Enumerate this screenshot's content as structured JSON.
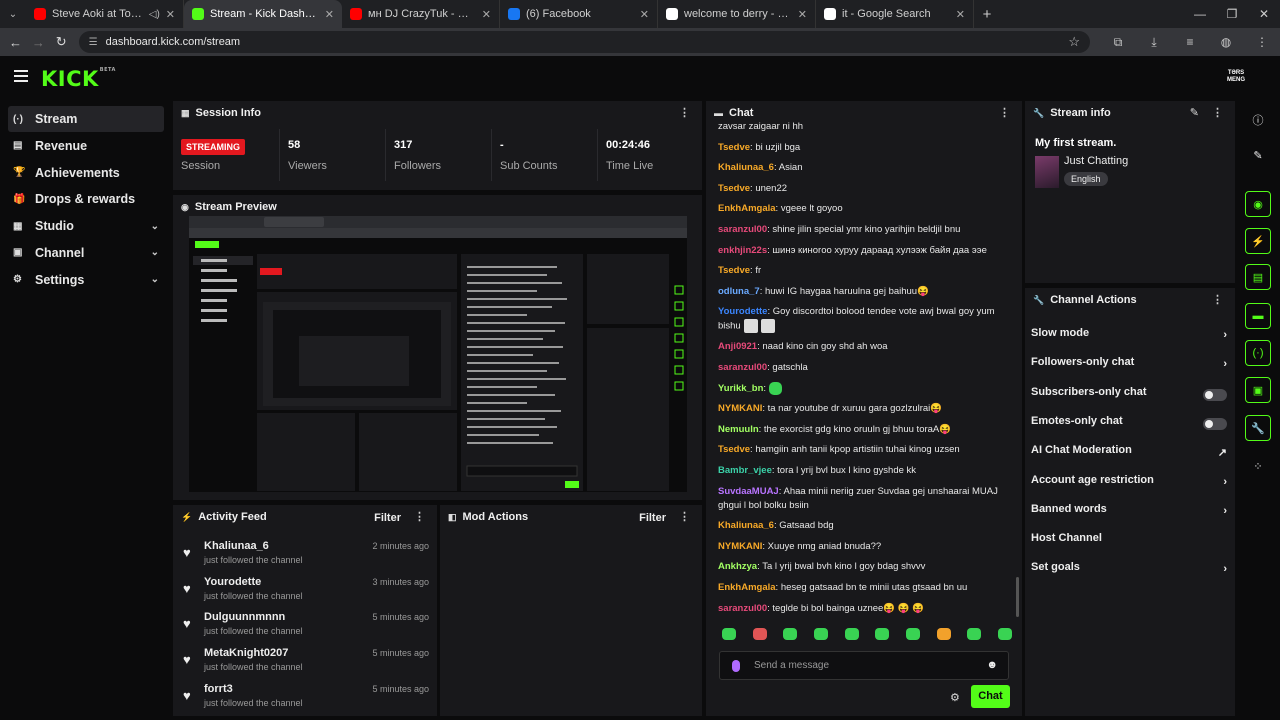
{
  "browser": {
    "tabs": [
      {
        "title": "Steve Aoki at Tomorrowland",
        "color": "#ff0000"
      },
      {
        "title": "Stream - Kick Dashboard",
        "color": "#53fc18"
      },
      {
        "title": "мн DJ CrazyTuk - Mixset (LIVE)",
        "color": "#ff0000"
      },
      {
        "title": "(6) Facebook",
        "color": "#1877f2"
      },
      {
        "title": "welcome to derry - Google Sea",
        "color": "#ffffff"
      },
      {
        "title": "it - Google Search",
        "color": "#ffffff"
      }
    ],
    "url": "dashboard.kick.com/stream"
  },
  "brand": {
    "logo": "KICK",
    "beta": "BETA",
    "accent": "#53fc18",
    "avatar_text": "TƏRS MENG"
  },
  "nav": [
    {
      "label": "Stream",
      "icon": "broadcast-icon",
      "glyph": "(·)",
      "active": true,
      "chevron": false
    },
    {
      "label": "Revenue",
      "icon": "revenue-icon",
      "glyph": "▤",
      "active": false,
      "chevron": false
    },
    {
      "label": "Achievements",
      "icon": "trophy-icon",
      "glyph": "🏆",
      "active": false,
      "chevron": false
    },
    {
      "label": "Drops & rewards",
      "icon": "gift-icon",
      "glyph": "🎁",
      "active": false,
      "chevron": false
    },
    {
      "label": "Studio",
      "icon": "studio-icon",
      "glyph": "▦",
      "active": false,
      "chevron": true
    },
    {
      "label": "Channel",
      "icon": "channel-icon",
      "glyph": "▣",
      "active": false,
      "chevron": true
    },
    {
      "label": "Settings",
      "icon": "gear-icon",
      "glyph": "⚙",
      "active": false,
      "chevron": true
    }
  ],
  "session": {
    "title": "Session Info",
    "status": "STREAMING",
    "stats": [
      {
        "value": "",
        "label": "Session"
      },
      {
        "value": "58",
        "label": "Viewers"
      },
      {
        "value": "317",
        "label": "Followers"
      },
      {
        "value": "-",
        "label": "Sub Counts"
      },
      {
        "value": "00:24:46",
        "label": "Time Live"
      }
    ]
  },
  "preview": {
    "title": "Stream Preview"
  },
  "activity": {
    "title": "Activity Feed",
    "filter": "Filter",
    "items": [
      {
        "name": "Khaliunaa_6",
        "sub": "just followed the channel",
        "time": "2 minutes ago"
      },
      {
        "name": "Yourodette",
        "sub": "just followed the channel",
        "time": "3 minutes ago"
      },
      {
        "name": "Dulguunnmnnn",
        "sub": "just followed the channel",
        "time": "5 minutes ago"
      },
      {
        "name": "MetaKnight0207",
        "sub": "just followed the channel",
        "time": "5 minutes ago"
      },
      {
        "name": "forrt3",
        "sub": "just followed the channel",
        "time": "5 minutes ago"
      }
    ]
  },
  "mod": {
    "title": "Mod Actions",
    "filter": "Filter"
  },
  "chat": {
    "title": "Chat",
    "messages": [
      {
        "user": "",
        "color": "#ffffff",
        "text": "zavsar zaigaar ni hh"
      },
      {
        "user": "Tsedve",
        "color": "#f7a928",
        "text": "bi uzjil bga"
      },
      {
        "user": "Khaliunaa_6",
        "color": "#f7a928",
        "text": "Asian"
      },
      {
        "user": "Tsedve",
        "color": "#f7a928",
        "text": "unen22"
      },
      {
        "user": "EnkhAmgala",
        "color": "#f7a928",
        "text": "vgeee lt goyoo"
      },
      {
        "user": "saranzul00",
        "color": "#e64a7a",
        "text": "shine jilin special ymr kino yarihjin beldjil bnu"
      },
      {
        "user": "enkhjin22s",
        "color": "#e64a7a",
        "text": "шинэ киноrоо хуруу дараад хулээж байя даа ээе"
      },
      {
        "user": "Tsedve",
        "color": "#f7a928",
        "text": "fr"
      },
      {
        "user": "odluna_7",
        "color": "#6aa9ff",
        "text": "huwi IG haygaa haruulna gej baihuu😝"
      },
      {
        "user": "Yourodette",
        "color": "#3b86ff",
        "text": "Goy discordtoi bolood tendee vote awj bwal goy yum bishu"
      },
      {
        "user": "Anji0921",
        "color": "#e64a7a",
        "text": "naad kino cin goy shd ah woa"
      },
      {
        "user": "saranzul00",
        "color": "#e64a7a",
        "text": "gatschla"
      },
      {
        "user": "Yurikk_bn",
        "color": "#a2ff63",
        "text": ""
      },
      {
        "user": "NYMKANI",
        "color": "#f7a928",
        "text": "ta nar youtube dr xuruu gara gozlzulrai😝"
      },
      {
        "user": "Nemuuln",
        "color": "#a2ff63",
        "text": "the exorcist gdg kino oruuln gj bhuu toraA😝"
      },
      {
        "user": "Tsedve",
        "color": "#f7a928",
        "text": "hamgiin anh tanii kpop artistiin tuhai kinog uzsen"
      },
      {
        "user": "Bambr_vjee",
        "color": "#3bd1a8",
        "text": "tora l yrij bvl bux l kino gyshde kk"
      },
      {
        "user": "SuvdaaMUAJ",
        "color": "#b874ff",
        "text": "Ahaa minii neriig zuer Suvdaa gej unshaarai MUAJ ghgui l bol bolku bsiin"
      },
      {
        "user": "Khaliunaa_6",
        "color": "#f7a928",
        "text": "Gatsaad bdg"
      },
      {
        "user": "NYMKANI",
        "color": "#f7a928",
        "text": "Xuuye nmg aniad bnuda??"
      },
      {
        "user": "Ankhzya",
        "color": "#a2ff63",
        "text": "Ta l yrij bwal bvh kino l goy bdag shvvv"
      },
      {
        "user": "EnkhAmgala",
        "color": "#f7a928",
        "text": "heseg gatsaad bn te minii utas gtsaad bn uu"
      },
      {
        "user": "saranzul00",
        "color": "#e64a7a",
        "text": "teglde bi bol bainga uznee😝 😝 😝"
      }
    ],
    "placeholder": "Send a message",
    "send_label": "Chat"
  },
  "stream_info": {
    "title": "Stream info",
    "stream_title": "My first stream.",
    "category": "Just Chatting",
    "language": "English"
  },
  "channel_actions": {
    "title": "Channel Actions",
    "items": [
      {
        "label": "Slow mode",
        "control": "chevron"
      },
      {
        "label": "Followers-only chat",
        "control": "chevron"
      },
      {
        "label": "Subscribers-only chat",
        "control": "toggle"
      },
      {
        "label": "Emotes-only chat",
        "control": "toggle"
      },
      {
        "label": "AI Chat Moderation",
        "control": "external"
      },
      {
        "label": "Account age restriction",
        "control": "chevron"
      },
      {
        "label": "Banned words",
        "control": "chevron"
      },
      {
        "label": "Host Channel",
        "control": "none"
      },
      {
        "label": "Set goals",
        "control": "chevron"
      }
    ]
  },
  "rail": [
    {
      "icon": "info-icon",
      "glyph": "ⓘ",
      "green": false
    },
    {
      "icon": "pencil-icon",
      "glyph": "✎",
      "green": false
    },
    {
      "icon": "camera-icon",
      "glyph": "◉",
      "green": true
    },
    {
      "icon": "lightning-icon",
      "glyph": "⚡",
      "green": true
    },
    {
      "icon": "document-icon",
      "glyph": "▤",
      "green": true
    },
    {
      "icon": "chat-bubble-icon",
      "glyph": "▬",
      "green": true
    },
    {
      "icon": "broadcast-icon",
      "glyph": "(·)",
      "green": true
    },
    {
      "icon": "layout-icon",
      "glyph": "▣",
      "green": true
    },
    {
      "icon": "wrench-icon",
      "glyph": "🔧",
      "green": true
    },
    {
      "icon": "apps-icon",
      "glyph": "⁘",
      "green": false
    }
  ]
}
